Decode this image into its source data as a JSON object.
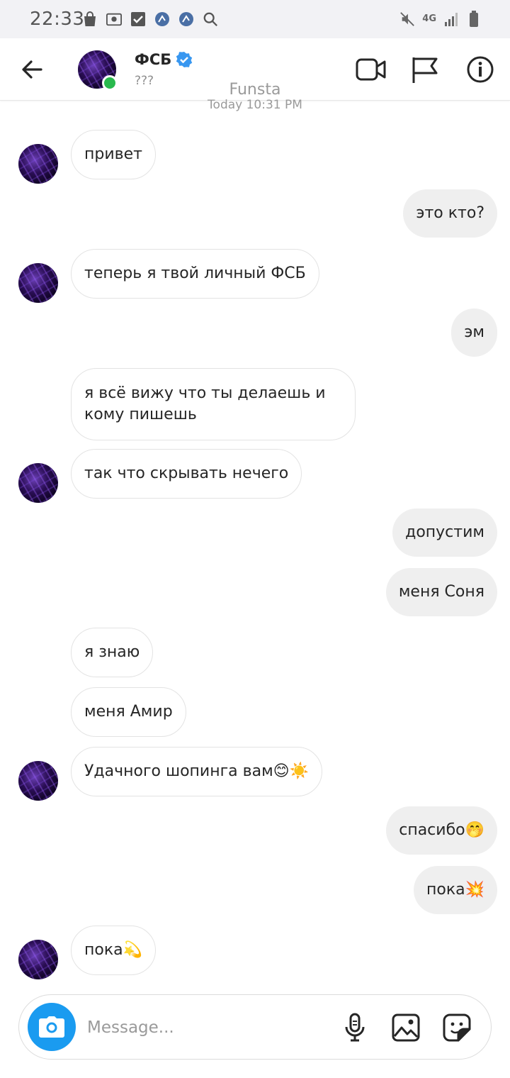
{
  "status_bar": {
    "time": "22:33",
    "network": "4G",
    "left_icons": [
      "shopping-bag-icon",
      "radio-icon",
      "checkbox-icon",
      "running-app-icon",
      "running-app-icon",
      "search-icon"
    ],
    "right_icons": [
      "mute-icon",
      "network-4g-icon",
      "signal-icon",
      "battery-icon"
    ]
  },
  "header": {
    "name": "ФСБ",
    "subtitle": "???",
    "verified": true,
    "online": true
  },
  "watermark": "Funsta",
  "date_separator": "Today 10:31 PM",
  "messages": [
    {
      "dir": "in",
      "text": "привет"
    },
    {
      "dir": "out",
      "text": "это кто?"
    },
    {
      "dir": "in",
      "text": "теперь я твой личный ФСБ"
    },
    {
      "dir": "out",
      "text": "эм"
    },
    {
      "dir": "in",
      "text": "я всё вижу что ты делаешь и кому пишешь"
    },
    {
      "dir": "in",
      "text": "так что скрывать нечего"
    },
    {
      "dir": "out",
      "text": "допустим"
    },
    {
      "dir": "out",
      "text": "меня Соня"
    },
    {
      "dir": "in",
      "text": "я знаю"
    },
    {
      "dir": "in",
      "text": "меня Амир"
    },
    {
      "dir": "in",
      "text": "Удачного шопинга вам😊☀️"
    },
    {
      "dir": "out",
      "text": "спасибо🤭"
    },
    {
      "dir": "out",
      "text": "пока💥"
    },
    {
      "dir": "in",
      "text": "пока💫"
    }
  ],
  "composer": {
    "placeholder": "Message..."
  },
  "colors": {
    "accent": "#1a9bf0",
    "online": "#29b94d",
    "incoming_bg": "#ffffff",
    "outgoing_bg": "#efefef"
  }
}
